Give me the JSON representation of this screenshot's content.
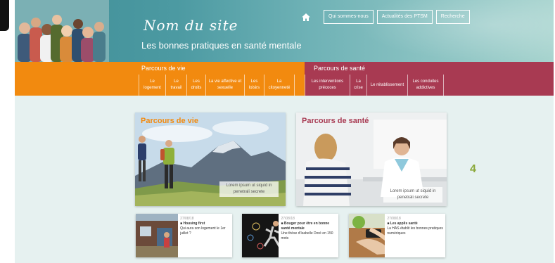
{
  "header": {
    "site_title": "Nom du site",
    "tagline": "Les bonnes pratiques en santé mentale",
    "nav": [
      {
        "label": "Qui sommes-nous"
      },
      {
        "label": "Actualités des PTSM"
      },
      {
        "label": "Recherche"
      }
    ],
    "home_icon": "home-icon"
  },
  "categories": {
    "vie": {
      "label": "Parcours de vie",
      "color": "#f28a0f",
      "items": [
        {
          "label": "Le logement"
        },
        {
          "label": "Le travail"
        },
        {
          "label": "Les droits"
        },
        {
          "label": "La vie affective et sexuelle"
        },
        {
          "label": "Les loisirs"
        },
        {
          "label": "La citoyenneté"
        }
      ]
    },
    "sante": {
      "label": "Parcours de santé",
      "color": "#a83a52",
      "items": [
        {
          "label": "Les interventions précoces"
        },
        {
          "label": "La crise"
        },
        {
          "label": "Le rétablissement"
        },
        {
          "label": "Les conduites addictives"
        }
      ]
    }
  },
  "feature_cards": [
    {
      "title": "Parcours de vie",
      "caption": "Lorem ipsum ut siquid in penetrali secrete",
      "title_color": "#f28a0f"
    },
    {
      "title": "Parcours de santé",
      "caption": "Lorem ipsum ut siquid in penetrali secrete",
      "title_color": "#a83a52"
    }
  ],
  "side_number": "4",
  "news": [
    {
      "date": "27/08/18",
      "title": "■ Housing first",
      "body": "Qui aura son logement le 1er juillet ?"
    },
    {
      "date": "27/08/18",
      "title": "■ Bouger pour être en bonne santé mentale",
      "body": "Une thèse d'Isabelle Doré en 150 mots"
    },
    {
      "date": "27/08/18",
      "title": "■ Les applis santé",
      "body": "La HAS établit les bonnes pratiques numériques"
    }
  ]
}
